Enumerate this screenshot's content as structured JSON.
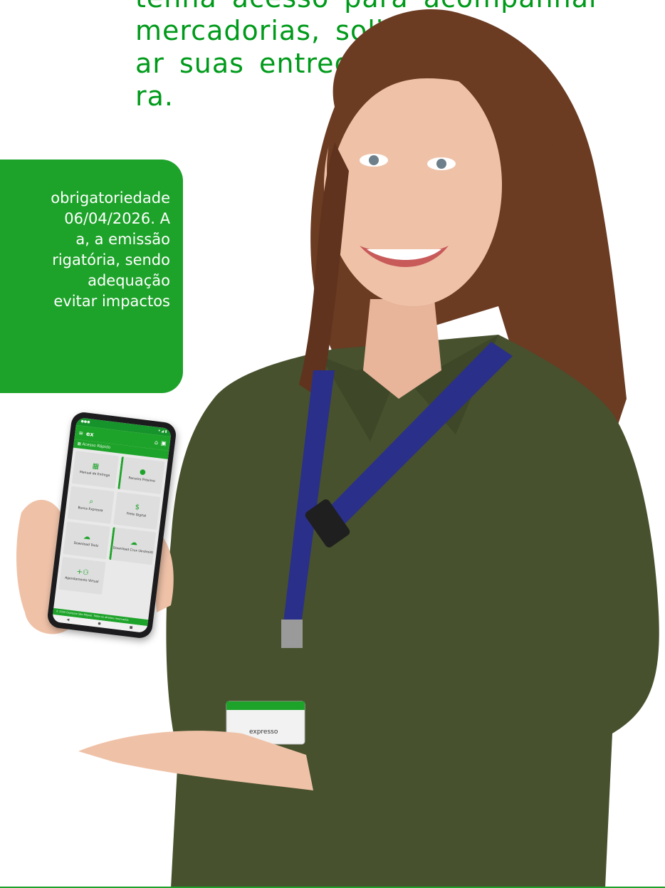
{
  "intro": {
    "line1": "tenha acesso para acompanhar",
    "line2": "mercadorias,  solicitar",
    "line3": "ar  suas  entregas  de",
    "line4": "ra."
  },
  "notice": {
    "line1": "obrigatoriedade",
    "line2": "06/04/2026. A",
    "line3": "a,   a   emissão",
    "line4": "rigatória, sendo",
    "line5": "adequação",
    "line6": "evitar  impactos"
  },
  "phone": {
    "app_brand": "ex",
    "section_title": "Acesso Rápido",
    "tiles": [
      {
        "label": "Manual de Entrega",
        "icon": "calendar-icon"
      },
      {
        "label": "Parceiro Próximo",
        "icon": "location-pin-icon"
      },
      {
        "label": "Busca Expressa",
        "icon": "search-icon"
      },
      {
        "label": "Frete Digital",
        "icon": "dollar-icon"
      },
      {
        "label": "Download Toolz",
        "icon": "cloud-download-icon"
      },
      {
        "label": "Download Crux (Android)",
        "icon": "cloud-download-icon"
      },
      {
        "label": "Agendamento Virtual",
        "icon": "add-users-icon"
      }
    ],
    "footer": "© 2025 Expresso São Miguel. Todos os direitos reservados."
  },
  "badge_text": "expresso",
  "colors": {
    "brand_green": "#1ea32a",
    "text_green": "#009a1a",
    "shirt_green": "#47512e",
    "lanyard_blue": "#2a2f8a"
  }
}
